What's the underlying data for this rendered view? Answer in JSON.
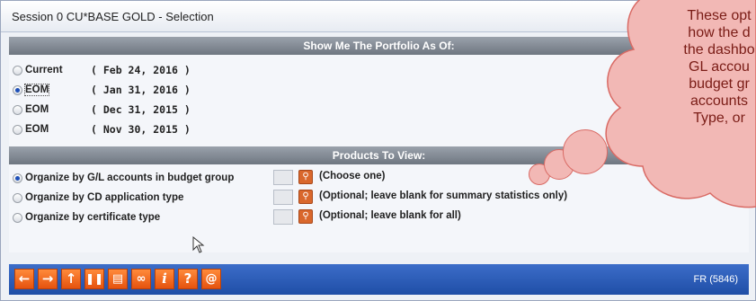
{
  "window": {
    "title": "Session 0 CU*BASE GOLD - Selection"
  },
  "portfolio": {
    "header": "Show Me The Portfolio As Of:",
    "options": [
      {
        "label": "Current",
        "date": "( Feb 24, 2016 )"
      },
      {
        "label": "EOM",
        "date": "( Jan 31, 2016 )"
      },
      {
        "label": "EOM",
        "date": "( Dec 31, 2015 )"
      },
      {
        "label": "EOM",
        "date": "( Nov 30, 2015 )"
      }
    ],
    "selected_index": 1
  },
  "products": {
    "header": "Products To View:",
    "options": [
      {
        "label": "Organize by G/L accounts in budget group",
        "value": "",
        "hint": "(Choose one)"
      },
      {
        "label": "Organize by CD application type",
        "value": "",
        "hint": "(Optional; leave blank for summary statistics only)"
      },
      {
        "label": "Organize by certificate type",
        "value": "",
        "hint": "(Optional; leave blank for all)"
      }
    ],
    "selected_index": 0
  },
  "toolbar": {
    "buttons": [
      "back-arrow-icon",
      "forward-arrow-icon",
      "up-arrow-icon",
      "pause-icon",
      "print-icon",
      "link-icon",
      "info-icon",
      "help-icon",
      "at-sign-icon"
    ],
    "screen_id": "FR (5846)"
  },
  "callout": {
    "lines": [
      "These opt",
      "how the d",
      "the dashbo",
      "GL accou",
      "budget gr",
      "accounts",
      "Type, or"
    ]
  },
  "colors": {
    "toolbar": "#2a5bb8",
    "toolbar_button": "#f06a1e",
    "section_bar": "#7f8791",
    "callout_fill": "#f2b8b5",
    "callout_text": "#7a1c16",
    "radio_selected": "#1d4fb8"
  }
}
